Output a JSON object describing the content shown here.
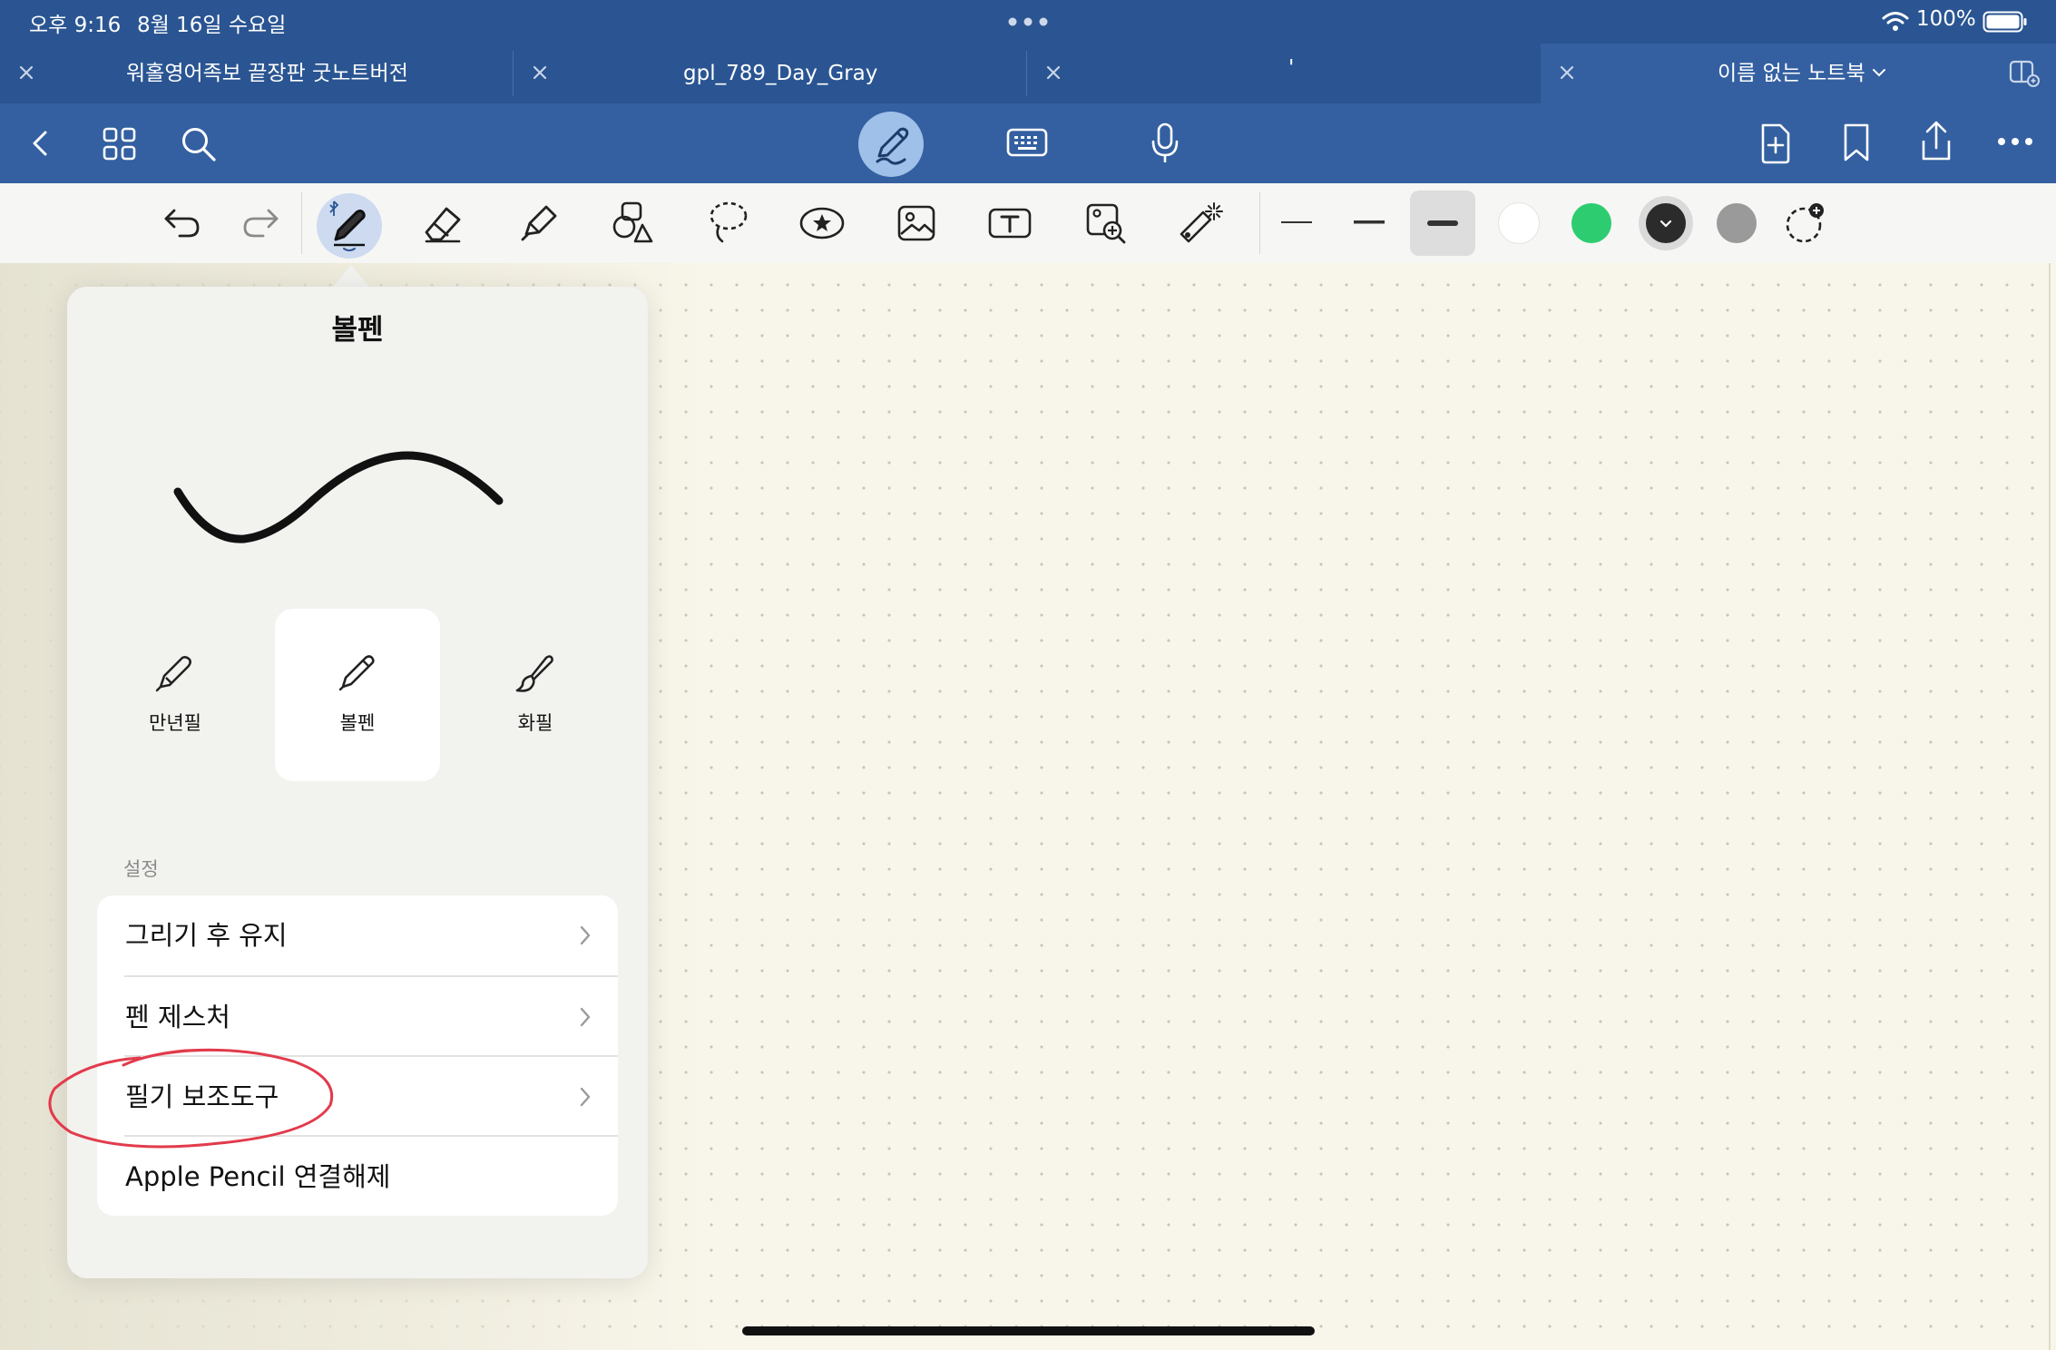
{
  "status": {
    "time": "오후 9:16",
    "date": "8월 16일 수요일",
    "battery": "100%"
  },
  "tabs": [
    {
      "label": "워홀영어족보 끝장판 굿노트버전"
    },
    {
      "label": "gpl_789_Day_Gray"
    },
    {
      "label": "'"
    },
    {
      "label": "이름 없는 노트북"
    }
  ],
  "popover": {
    "title": "볼펜",
    "pen_types": [
      {
        "label": "만년필"
      },
      {
        "label": "볼펜"
      },
      {
        "label": "화필"
      }
    ],
    "section_label": "설정",
    "menu": [
      {
        "label": "그리기 후 유지"
      },
      {
        "label": "펜 제스처"
      },
      {
        "label": "필기 보조도구"
      },
      {
        "label": "Apple Pencil 연결해제"
      }
    ]
  },
  "colors": {
    "chrome": "#2a5592",
    "toolbar": "#3460a1",
    "swatch_white": "#ffffff",
    "swatch_green": "#2ecc71",
    "swatch_black": "#2b2b2b",
    "swatch_gray": "#9a9a9a",
    "annotation": "#e23b4c"
  }
}
